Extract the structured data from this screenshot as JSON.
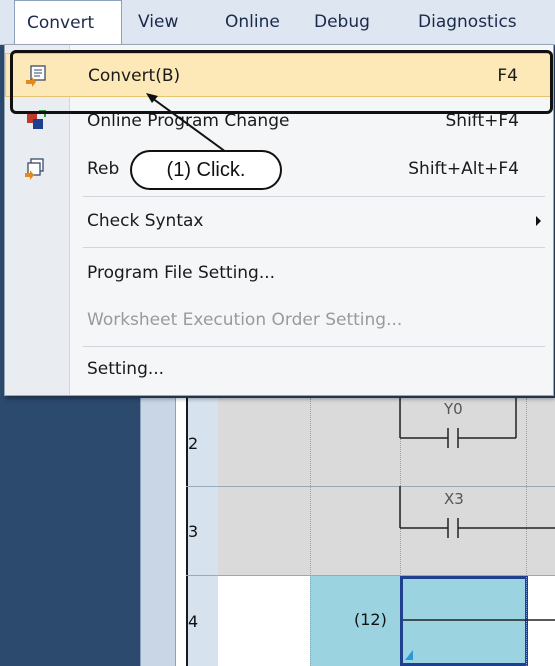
{
  "menubar": {
    "items": [
      {
        "label": "Convert",
        "active": true
      },
      {
        "label": "View"
      },
      {
        "label": "Online"
      },
      {
        "label": "Debug"
      },
      {
        "label": "Diagnostics"
      }
    ]
  },
  "dropdown": {
    "items": [
      {
        "label": "Convert(B)",
        "shortcut": "F4",
        "icon": "convert-icon",
        "state": "highlighted"
      },
      {
        "label": "Online Program Change",
        "shortcut": "Shift+F4",
        "icon": "online-program-change-icon"
      },
      {
        "label": "Reb",
        "shortcut": "Shift+Alt+F4",
        "icon": "rebuild-icon"
      },
      {
        "label": "Check Syntax",
        "submenu": true
      },
      {
        "label": "Program File Setting..."
      },
      {
        "label": "Worksheet Execution Order Setting...",
        "disabled": true
      },
      {
        "label": "Setting..."
      }
    ]
  },
  "annotation": {
    "callout_text": "(1) Click."
  },
  "ladder": {
    "rows": [
      {
        "number": "2",
        "device": "Y0"
      },
      {
        "number": "3",
        "device": "X3"
      },
      {
        "number": "4",
        "step": "(12)"
      }
    ]
  },
  "colors": {
    "highlight_bg": "#fde9b8",
    "edit_cell": "#9bd3e1",
    "cursor": "#1f3f8f"
  }
}
